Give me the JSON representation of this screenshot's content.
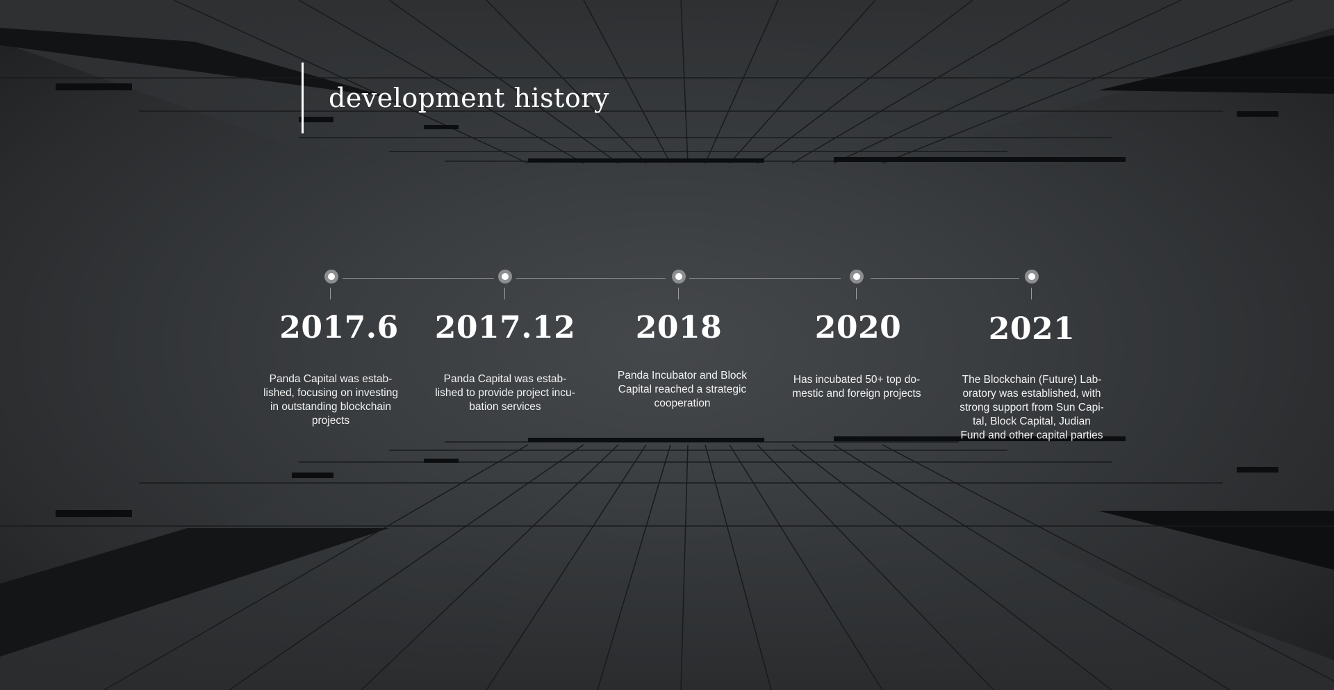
{
  "page": {
    "title": "development history"
  },
  "timeline": {
    "events": [
      {
        "year": "2017.6",
        "description": "Panda Capital was estab-\nlished, focusing on investing\nin outstanding blockchain\nprojects"
      },
      {
        "year": "2017.12",
        "description": "Panda Capital was estab-\nlished to provide project incu-\nbation services"
      },
      {
        "year": "2018",
        "description": "Panda Incubator and Block\nCapital reached a strategic\ncooperation"
      },
      {
        "year": "2020",
        "description": "Has incubated 50+ top do-\nmestic and foreign projects"
      },
      {
        "year": "2021",
        "description": "The Blockchain (Future) Lab-\noratory was established, with\nstrong support from Sun Capi-\ntal, Block Capital, Judian\nFund and other capital parties"
      }
    ]
  },
  "colors": {
    "background": "#3a3d40",
    "text": "#ffffff",
    "axis": "#8a8c8e",
    "dot_ring": "#8c8e90"
  },
  "icons": {
    "timeline_marker": "timeline-dot-icon"
  }
}
